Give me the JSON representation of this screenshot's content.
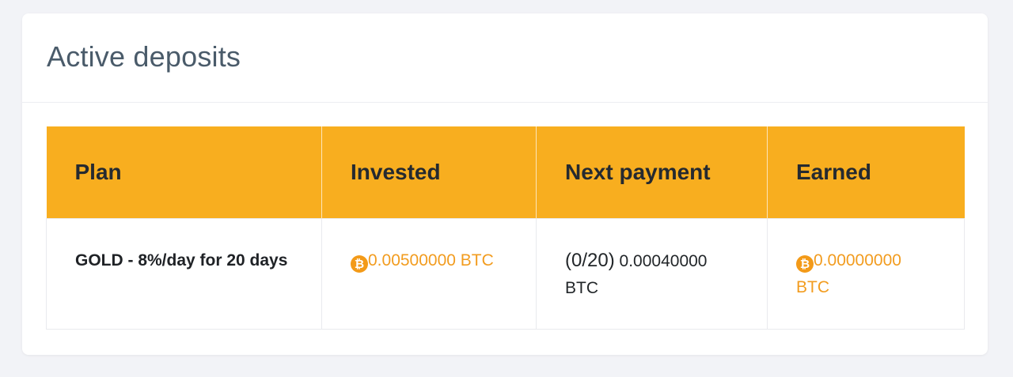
{
  "card": {
    "title": "Active deposits"
  },
  "table": {
    "columns": [
      "Plan",
      "Invested",
      "Next payment",
      "Earned"
    ],
    "rows": [
      {
        "plan": "GOLD - 8%/day for 20 days",
        "invested": "0.00500000 BTC",
        "next_payment_count": "(0/20)",
        "next_payment_amount": " 0.00040000 BTC",
        "earned": "0.00000000 BTC"
      }
    ]
  },
  "icons": {
    "currency": "bitcoin-icon"
  },
  "colors": {
    "header_bg": "#f8ae1f",
    "accent_orange": "#f29c1f",
    "title": "#4a5b6a"
  }
}
